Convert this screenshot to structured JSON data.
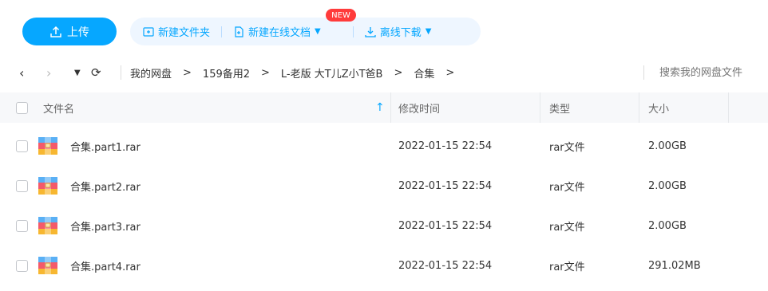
{
  "toolbar": {
    "upload_label": "上传",
    "new_folder_label": "新建文件夹",
    "new_online_doc_label": "新建在线文档",
    "new_badge": "NEW",
    "offline_download_label": "离线下载"
  },
  "nav": {
    "breadcrumbs": [
      "我的网盘",
      "159备用2",
      "L-老版 大T儿Z小T爸B",
      "合集"
    ],
    "search_placeholder": "搜索我的网盘文件"
  },
  "table": {
    "columns": {
      "name": "文件名",
      "modified": "修改时间",
      "type": "类型",
      "size": "大小"
    },
    "rows": [
      {
        "name": "合集.part1.rar",
        "modified": "2022-01-15 22:54",
        "type": "rar文件",
        "size": "2.00GB"
      },
      {
        "name": "合集.part2.rar",
        "modified": "2022-01-15 22:54",
        "type": "rar文件",
        "size": "2.00GB"
      },
      {
        "name": "合集.part3.rar",
        "modified": "2022-01-15 22:54",
        "type": "rar文件",
        "size": "2.00GB"
      },
      {
        "name": "合集.part4.rar",
        "modified": "2022-01-15 22:54",
        "type": "rar文件",
        "size": "291.02MB"
      }
    ]
  },
  "colors": {
    "accent": "#06a7ff",
    "badge": "#ff3b3b"
  }
}
